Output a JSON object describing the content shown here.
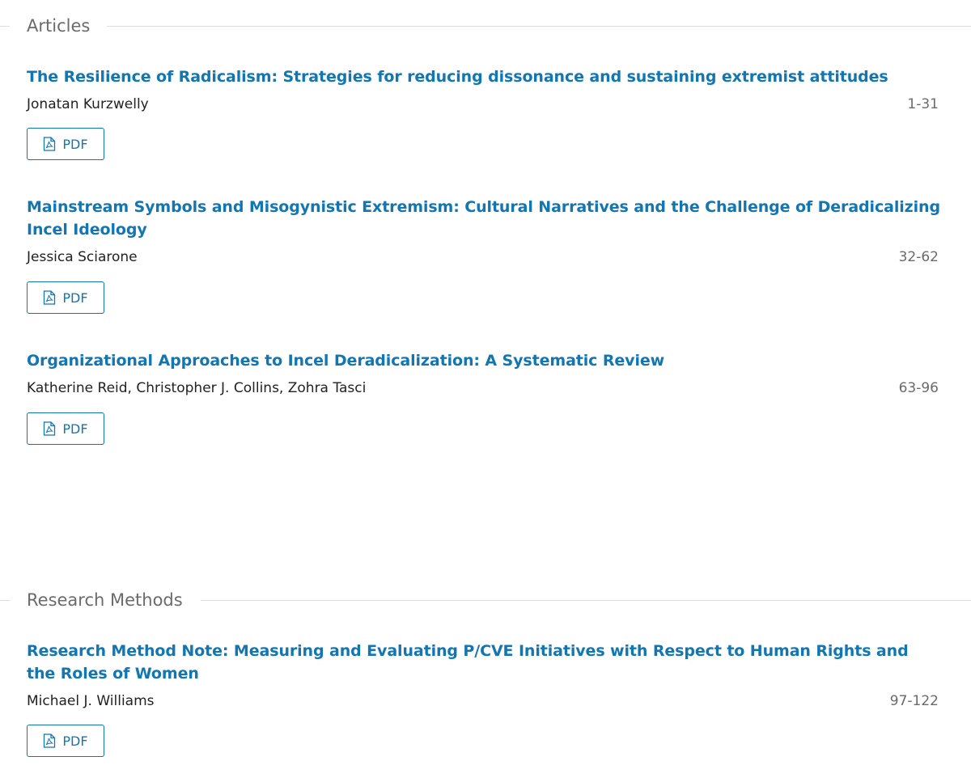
{
  "sections": [
    {
      "title": "Articles",
      "articles": [
        {
          "title": "The Resilience of Radicalism: Strategies for reducing dissonance and sustaining extremist attitudes",
          "authors": "Jonatan Kurzwelly",
          "pages": "1-31",
          "pdf_label": "PDF"
        },
        {
          "title": "Mainstream Symbols and Misogynistic Extremism: Cultural Narratives and the Challenge of Deradicalizing Incel Ideology",
          "authors": "Jessica Sciarone",
          "pages": "32-62",
          "pdf_label": "PDF"
        },
        {
          "title": "Organizational Approaches to Incel Deradicalization: A Systematic Review",
          "authors": "Katherine Reid, Christopher J. Collins, Zohra Tasci",
          "pages": "63-96",
          "pdf_label": "PDF"
        }
      ]
    },
    {
      "title": "Research Methods",
      "articles": [
        {
          "title": "Research Method Note: Measuring and Evaluating P/CVE Initiatives with Respect to Human Rights and the Roles of Women",
          "authors": "Michael J. Williams",
          "pages": "97-122",
          "pdf_label": "PDF"
        }
      ]
    }
  ],
  "icons": {
    "pdf": "pdf-file-icon"
  },
  "colors": {
    "link": "#1276b3",
    "heading": "#6b6b6b",
    "rule": "#dddddd",
    "text": "#222222"
  }
}
